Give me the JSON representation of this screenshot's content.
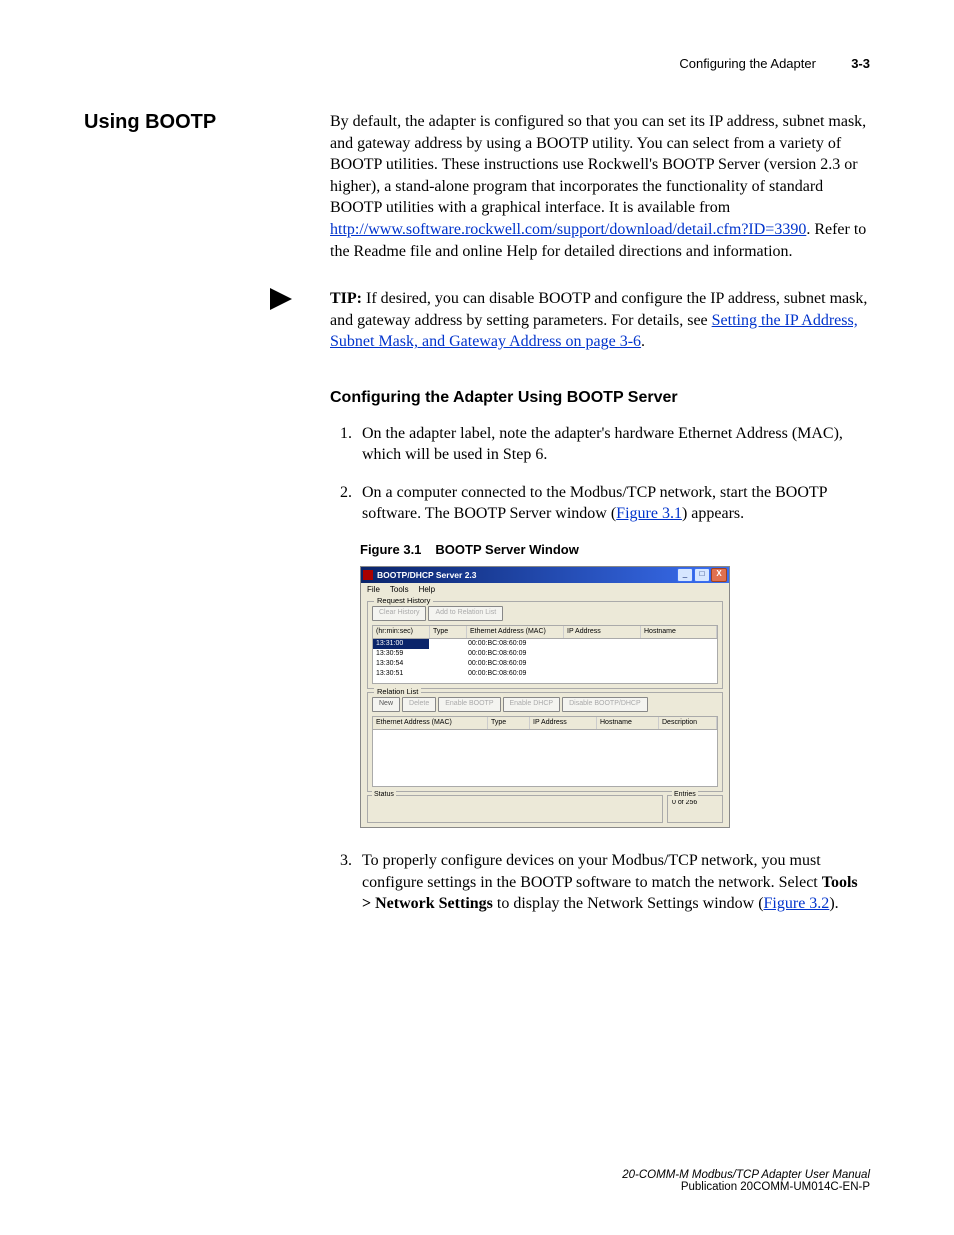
{
  "header": {
    "chapter_title": "Configuring the Adapter",
    "page_num": "3-3"
  },
  "section": {
    "heading": "Using BOOTP",
    "p1_pre": "By default, the adapter is configured so that you can set its IP address, subnet mask, and gateway address by using a BOOTP utility. You can select from a variety of BOOTP utilities. These instructions use Rockwell's BOOTP Server (version 2.3 or higher), a stand-alone program that incorporates the functionality of standard BOOTP utilities with a graphical interface. It is available from ",
    "p1_link": "http://www.software.rockwell.com/support/download/detail.cfm?ID=3390",
    "p1_post": ". Refer to the Readme file and online Help for detailed directions and information."
  },
  "tip": {
    "label": "TIP:",
    "text_pre": "  If desired, you can disable BOOTP and configure the IP address, subnet mask, and gateway address by setting parameters. For details, see ",
    "link": "Setting the IP Address, Subnet Mask, and Gateway Address on page 3-6",
    "text_post": "."
  },
  "subheading": "Configuring the Adapter Using BOOTP Server",
  "steps": {
    "s1": "On the adapter label, note the adapter's hardware Ethernet Address (MAC), which will be used in Step 6.",
    "s2_pre": "On a computer connected to the Modbus/TCP network, start the BOOTP software. The BOOTP Server window (",
    "s2_link": "Figure 3.1",
    "s2_post": ") appears.",
    "s3_pre": "To properly configure devices on your Modbus/TCP network, you must configure settings in the BOOTP software to match the network. Select ",
    "s3_bold": "Tools > Network Settings",
    "s3_mid": " to display the Network Settings window (",
    "s3_link": "Figure 3.2",
    "s3_post": ")."
  },
  "figure": {
    "label": "Figure 3.1",
    "title": "BOOTP Server Window"
  },
  "bootp": {
    "title": "BOOTP/DHCP Server 2.3",
    "menu": {
      "file": "File",
      "tools": "Tools",
      "help": "Help"
    },
    "req": {
      "label": "Request History",
      "btn_clear": "Clear History",
      "btn_add": "Add to Relation List",
      "cols": {
        "time": "(hr:min:sec)",
        "type": "Type",
        "mac": "Ethernet Address (MAC)",
        "ip": "IP Address",
        "host": "Hostname"
      },
      "rows": [
        {
          "time": "13:31:00",
          "type": "",
          "mac": "00:00:BC:08:60:09",
          "ip": "",
          "host": ""
        },
        {
          "time": "13:30:59",
          "type": "",
          "mac": "00:00:BC:08:60:09",
          "ip": "",
          "host": ""
        },
        {
          "time": "13:30:54",
          "type": "",
          "mac": "00:00:BC:08:60:09",
          "ip": "",
          "host": ""
        },
        {
          "time": "13:30:51",
          "type": "",
          "mac": "00:00:BC:08:60:09",
          "ip": "",
          "host": ""
        }
      ]
    },
    "rel": {
      "label": "Relation List",
      "btn_new": "New",
      "btn_del": "Delete",
      "btn_eb": "Enable BOOTP",
      "btn_ed": "Enable DHCP",
      "btn_db": "Disable BOOTP/DHCP",
      "cols": {
        "mac": "Ethernet Address (MAC)",
        "type": "Type",
        "ip": "IP Address",
        "host": "Hostname",
        "desc": "Description"
      }
    },
    "status": {
      "label": "Status",
      "entries_label": "Entries",
      "entries_val": "0 of 256"
    }
  },
  "footer": {
    "line1": "20-COMM-M Modbus/TCP Adapter User Manual",
    "line2": "Publication 20COMM-UM014C-EN-P"
  }
}
